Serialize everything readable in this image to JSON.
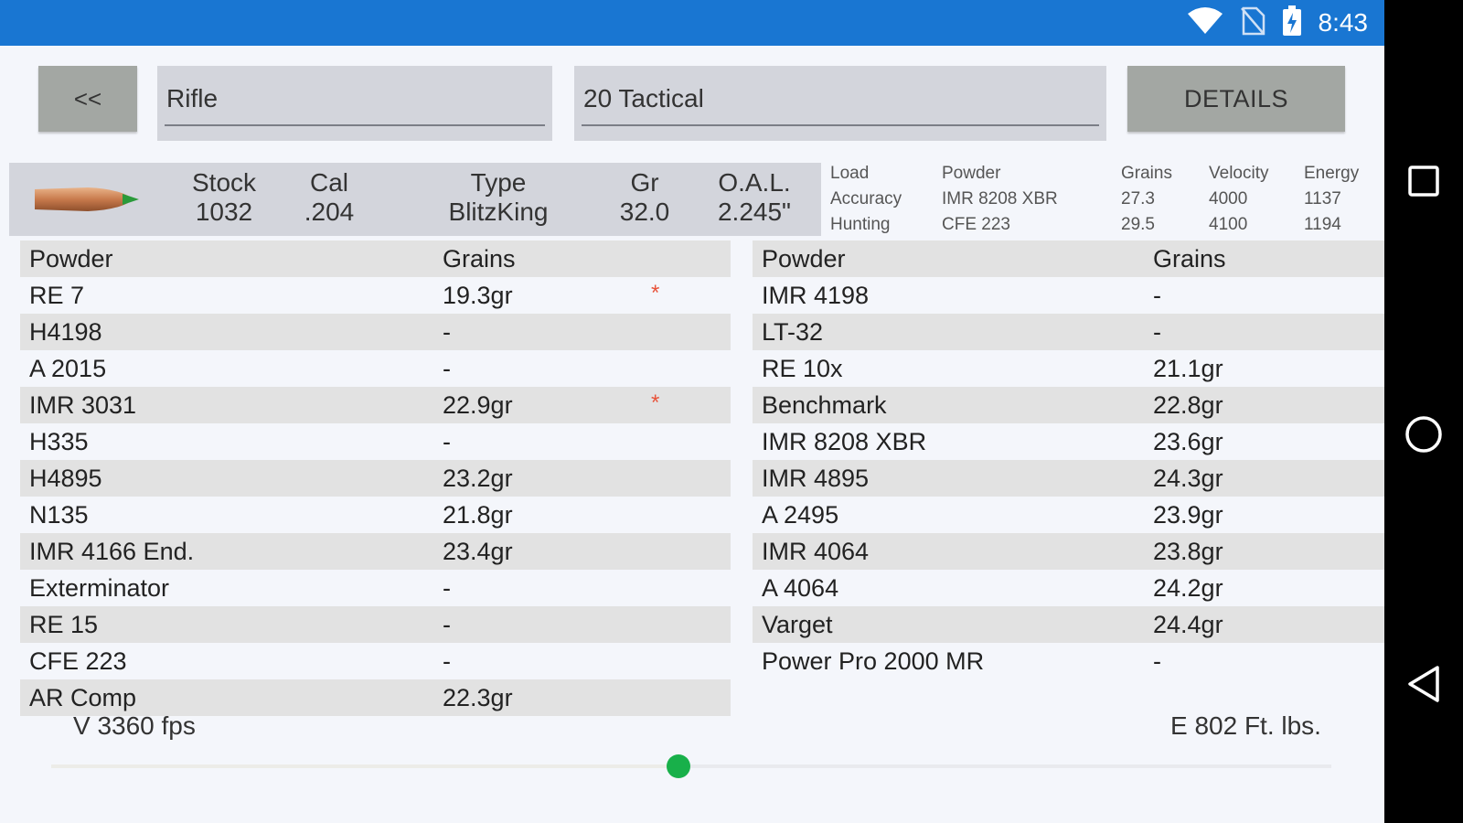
{
  "status_bar": {
    "time": "8:43",
    "icons": [
      "wifi-icon",
      "no-sim-icon",
      "battery-charging-icon"
    ]
  },
  "top_controls": {
    "back_label": "<<",
    "category": "Rifle",
    "cartridge": "20 Tactical",
    "details_label": "DETAILS"
  },
  "bullet_info": {
    "stock_label": "Stock",
    "stock_value": "1032",
    "cal_label": "Cal",
    "cal_value": ".204",
    "type_label": "Type",
    "type_value": "BlitzKing",
    "gr_label": "Gr",
    "gr_value": "32.0",
    "oal_label": "O.A.L.",
    "oal_value": "2.245\""
  },
  "loads": {
    "headers": {
      "load": "Load",
      "powder": "Powder",
      "grains": "Grains",
      "velocity": "Velocity",
      "energy": "Energy"
    },
    "rows": [
      {
        "load": "Accuracy",
        "powder": "IMR 8208 XBR",
        "grains": "27.3",
        "velocity": "4000",
        "energy": "1137"
      },
      {
        "load": "Hunting",
        "powder": "CFE 223",
        "grains": "29.5",
        "velocity": "4100",
        "energy": "1194"
      }
    ]
  },
  "left_table": {
    "header_powder": "Powder",
    "header_grains": "Grains",
    "rows": [
      {
        "powder": "RE 7",
        "grains": "19.3gr",
        "star": "*"
      },
      {
        "powder": "H4198",
        "grains": "-",
        "star": ""
      },
      {
        "powder": "A 2015",
        "grains": "-",
        "star": ""
      },
      {
        "powder": "IMR 3031",
        "grains": "22.9gr",
        "star": "*"
      },
      {
        "powder": "H335",
        "grains": "-",
        "star": ""
      },
      {
        "powder": "H4895",
        "grains": "23.2gr",
        "star": ""
      },
      {
        "powder": "N135",
        "grains": "21.8gr",
        "star": ""
      },
      {
        "powder": "IMR 4166 End.",
        "grains": "23.4gr",
        "star": ""
      },
      {
        "powder": "Exterminator",
        "grains": "-",
        "star": ""
      },
      {
        "powder": "RE 15",
        "grains": "-",
        "star": ""
      },
      {
        "powder": "CFE 223",
        "grains": "-",
        "star": ""
      },
      {
        "powder": "AR Comp",
        "grains": "22.3gr",
        "star": ""
      }
    ]
  },
  "right_table": {
    "header_powder": "Powder",
    "header_grains": "Grains",
    "rows": [
      {
        "powder": "IMR 4198",
        "grains": "-"
      },
      {
        "powder": "LT-32",
        "grains": "-"
      },
      {
        "powder": "RE 10x",
        "grains": "21.1gr"
      },
      {
        "powder": "Benchmark",
        "grains": "22.8gr"
      },
      {
        "powder": "IMR 8208 XBR",
        "grains": "23.6gr"
      },
      {
        "powder": "IMR 4895",
        "grains": "24.3gr"
      },
      {
        "powder": "A 2495",
        "grains": "23.9gr"
      },
      {
        "powder": "IMR 4064",
        "grains": "23.8gr"
      },
      {
        "powder": "A 4064",
        "grains": "24.2gr"
      },
      {
        "powder": "Varget",
        "grains": "24.4gr"
      },
      {
        "powder": "Power Pro 2000 MR",
        "grains": "-"
      }
    ]
  },
  "bottom": {
    "velocity": "V 3360 fps",
    "energy": "E 802 Ft. lbs.",
    "slider_fraction": 0.49
  },
  "colors": {
    "status_bar": "#1976d2",
    "accent_thumb": "#18b04a",
    "star": "#e8533a"
  }
}
